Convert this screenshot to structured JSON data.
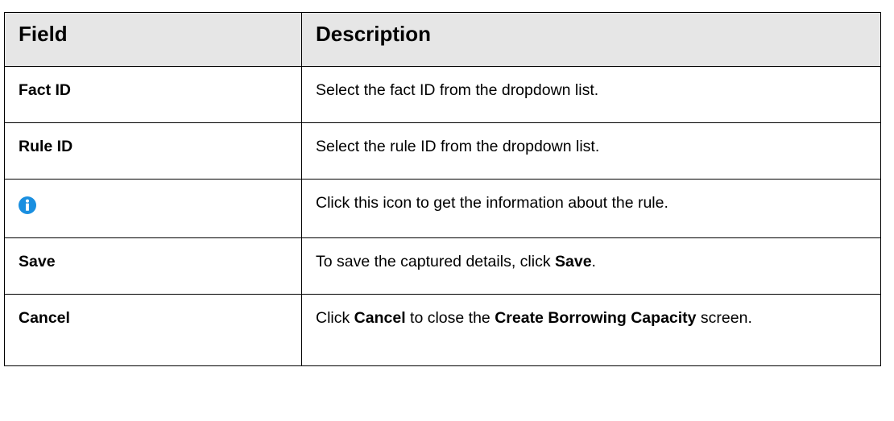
{
  "table": {
    "header": {
      "field": "Field",
      "description": "Description"
    },
    "rows": [
      {
        "field": "Fact ID",
        "description": "Select the fact ID from the dropdown list."
      },
      {
        "field": "Rule ID",
        "description": "Select the rule ID from the dropdown list."
      },
      {
        "field_icon": "info-icon",
        "description": "Click this icon to get the information about the rule."
      },
      {
        "field": "Save",
        "description_prefix": "To save the captured details, click ",
        "description_bold": "Save",
        "description_suffix": "."
      },
      {
        "field": "Cancel",
        "description_part1": "Click ",
        "description_bold1": "Cancel",
        "description_part2": " to close the ",
        "description_bold2": "Create Borrowing Capacity",
        "description_part3": " screen."
      }
    ]
  },
  "colors": {
    "header_background": "#e6e6e6",
    "border": "#000000",
    "info_icon": "#1a8fe0"
  }
}
